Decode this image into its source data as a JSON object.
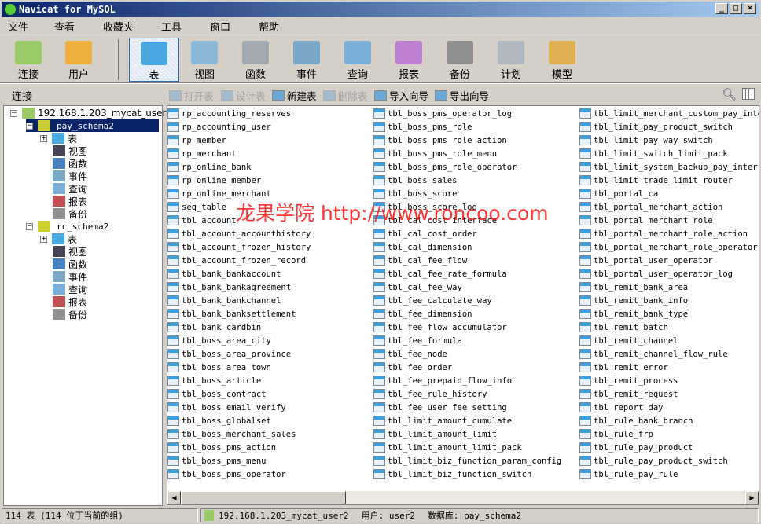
{
  "window": {
    "title": "Navicat for MySQL",
    "minimize": "_",
    "maximize": "□",
    "close": "×"
  },
  "menu": [
    "文件",
    "查看",
    "收藏夹",
    "工具",
    "窗口",
    "帮助"
  ],
  "toolbar": [
    {
      "label": "连接",
      "icon": "connection-icon",
      "color": "#9c6"
    },
    {
      "label": "用户",
      "icon": "user-icon",
      "color": "#f0b040"
    },
    {
      "label": "表",
      "icon": "table-icon",
      "color": "#4aa8e0",
      "active": true
    },
    {
      "label": "视图",
      "icon": "view-icon",
      "color": "#8ab8d8"
    },
    {
      "label": "函数",
      "icon": "function-icon",
      "color": "#a0a8b0"
    },
    {
      "label": "事件",
      "icon": "event-icon",
      "color": "#7aa8c8"
    },
    {
      "label": "查询",
      "icon": "query-icon",
      "color": "#7ab0d8"
    },
    {
      "label": "报表",
      "icon": "report-icon",
      "color": "#c080d0"
    },
    {
      "label": "备份",
      "icon": "backup-icon",
      "color": "#909090"
    },
    {
      "label": "计划",
      "icon": "schedule-icon",
      "color": "#b0b8c0"
    },
    {
      "label": "模型",
      "icon": "model-icon",
      "color": "#e0b050"
    }
  ],
  "subbar": {
    "connection_label": "连接",
    "actions": [
      {
        "label": "打开表",
        "disabled": true
      },
      {
        "label": "设计表",
        "disabled": true
      },
      {
        "label": "新建表",
        "disabled": false
      },
      {
        "label": "删除表",
        "disabled": true
      },
      {
        "label": "导入向导",
        "disabled": false
      },
      {
        "label": "导出向导",
        "disabled": false
      }
    ]
  },
  "tree": {
    "connection": "192.168.1.203_mycat_user2",
    "schemas": [
      {
        "name": "pay_schema2",
        "selected": true,
        "children": [
          "表",
          "视图",
          "函数",
          "事件",
          "查询",
          "报表",
          "备份"
        ]
      },
      {
        "name": "rc_schema2",
        "selected": false,
        "children": [
          "表",
          "视图",
          "函数",
          "事件",
          "查询",
          "报表",
          "备份"
        ]
      }
    ]
  },
  "tables": [
    [
      "rp_accounting_reserves",
      "rp_accounting_user",
      "rp_member",
      "rp_merchant",
      "rp_online_bank",
      "rp_online_member",
      "rp_online_merchant",
      "seq_table",
      "tbl_account",
      "tbl_account_accounthistory",
      "tbl_account_frozen_history",
      "tbl_account_frozen_record",
      "tbl_bank_bankaccount",
      "tbl_bank_bankagreement",
      "tbl_bank_bankchannel",
      "tbl_bank_banksettlement",
      "tbl_bank_cardbin",
      "tbl_boss_area_city",
      "tbl_boss_area_province",
      "tbl_boss_area_town",
      "tbl_boss_article",
      "tbl_boss_contract",
      "tbl_boss_email_verify",
      "tbl_boss_globalset",
      "tbl_boss_merchant_sales",
      "tbl_boss_pms_action",
      "tbl_boss_pms_menu",
      "tbl_boss_pms_operator"
    ],
    [
      "tbl_boss_pms_operator_log",
      "tbl_boss_pms_role",
      "tbl_boss_pms_role_action",
      "tbl_boss_pms_role_menu",
      "tbl_boss_pms_role_operator",
      "tbl_boss_sales",
      "tbl_boss_score",
      "tbl_boss_score_log",
      "tbl_cal_cost_interface",
      "tbl_cal_cost_order",
      "tbl_cal_dimension",
      "tbl_cal_fee_flow",
      "tbl_cal_fee_rate_formula",
      "tbl_cal_fee_way",
      "tbl_fee_calculate_way",
      "tbl_fee_dimension",
      "tbl_fee_flow_accumulator",
      "tbl_fee_formula",
      "tbl_fee_node",
      "tbl_fee_order",
      "tbl_fee_prepaid_flow_info",
      "tbl_fee_rule_history",
      "tbl_fee_user_fee_setting",
      "tbl_limit_amount_cumulate",
      "tbl_limit_amount_limit",
      "tbl_limit_amount_limit_pack",
      "tbl_limit_biz_function_param_config",
      "tbl_limit_biz_function_switch"
    ],
    [
      "tbl_limit_merchant_custom_pay_inter",
      "tbl_limit_pay_product_switch",
      "tbl_limit_pay_way_switch",
      "tbl_limit_switch_limit_pack",
      "tbl_limit_system_backup_pay_interfa",
      "tbl_limit_trade_limit_router",
      "tbl_portal_ca",
      "tbl_portal_merchant_action",
      "tbl_portal_merchant_role",
      "tbl_portal_merchant_role_action",
      "tbl_portal_merchant_role_operator",
      "tbl_portal_user_operator",
      "tbl_portal_user_operator_log",
      "tbl_remit_bank_area",
      "tbl_remit_bank_info",
      "tbl_remit_bank_type",
      "tbl_remit_batch",
      "tbl_remit_channel",
      "tbl_remit_channel_flow_rule",
      "tbl_remit_error",
      "tbl_remit_process",
      "tbl_remit_request",
      "tbl_report_day",
      "tbl_rule_bank_branch",
      "tbl_rule_frp",
      "tbl_rule_pay_product",
      "tbl_rule_pay_product_switch",
      "tbl_rule_pay_rule"
    ]
  ],
  "watermark": "龙果学院 http://www.roncoo.com",
  "status": {
    "count": "114 表 (114 位于当前的组)",
    "connection": "192.168.1.203_mycat_user2",
    "user": "用户: user2",
    "database": "数据库: pay_schema2"
  }
}
